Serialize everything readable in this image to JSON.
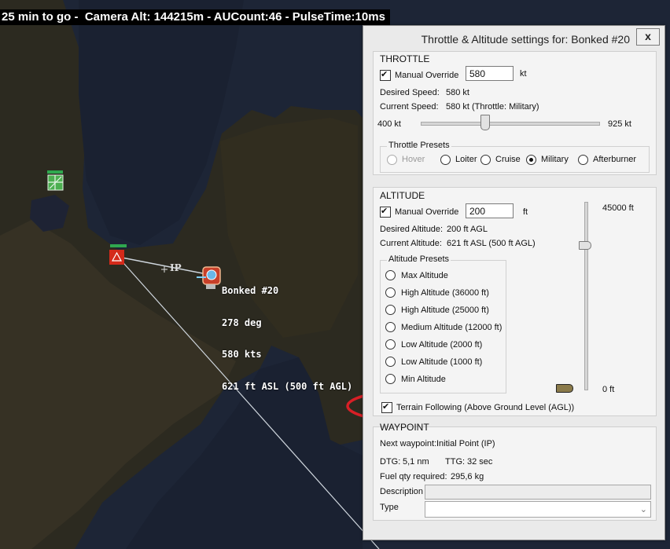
{
  "status_bar": {
    "text": "25 min to go -  Camera Alt: 144215m - AUCount:46 - PulseTime:10ms"
  },
  "map": {
    "ip_label": "IP",
    "unit": {
      "name": "Bonked #20",
      "heading": "278 deg",
      "speed": "580 kts",
      "altitude": "621 ft ASL (500 ft AGL)"
    },
    "colors": {
      "unit_marker": "#d42a1a",
      "facility_marker": "#3fbf3f",
      "annotation_ring": "#d81f26"
    }
  },
  "dialog": {
    "title": "Throttle & Altitude settings for: Bonked #20",
    "close_label": "x",
    "throttle": {
      "section_title": "THROTTLE",
      "manual_override_label": "Manual Override",
      "manual_override_checked": true,
      "speed_value": "580",
      "speed_unit": "kt",
      "desired_speed_label": "Desired Speed:",
      "desired_speed_value": "580 kt",
      "current_speed_label": "Current Speed:",
      "current_speed_value": "580 kt (Throttle: Military)",
      "slider_min": "400 kt",
      "slider_max": "925 kt",
      "slider_fraction": 0.35,
      "presets_title": "Throttle Presets",
      "presets": [
        {
          "label": "Hover",
          "selected": false,
          "enabled": false
        },
        {
          "label": "Loiter",
          "selected": false,
          "enabled": true
        },
        {
          "label": "Cruise",
          "selected": false,
          "enabled": true
        },
        {
          "label": "Military",
          "selected": true,
          "enabled": true
        },
        {
          "label": "Afterburner",
          "selected": false,
          "enabled": true
        }
      ]
    },
    "altitude": {
      "section_title": "ALTITUDE",
      "manual_override_label": "Manual Override",
      "manual_override_checked": true,
      "altitude_value": "200",
      "altitude_unit": "ft",
      "desired_altitude_label": "Desired Altitude:",
      "desired_altitude_value": "200 ft AGL",
      "current_altitude_label": "Current Altitude:",
      "current_altitude_value": "621 ft ASL (500 ft AGL)",
      "slider_top_label": "45000 ft",
      "slider_bottom_label": "0 ft",
      "slider_fraction": 0.78,
      "presets_title": "Altitude Presets",
      "presets": [
        {
          "label": "Max Altitude",
          "selected": false
        },
        {
          "label": "High Altitude (36000 ft)",
          "selected": false
        },
        {
          "label": "High Altitude (25000 ft)",
          "selected": false
        },
        {
          "label": "Medium Altitude (12000 ft)",
          "selected": false
        },
        {
          "label": "Low Altitude (2000 ft)",
          "selected": false
        },
        {
          "label": "Low Altitude (1000 ft)",
          "selected": false
        },
        {
          "label": "Min Altitude",
          "selected": false
        }
      ],
      "terrain_following_label": "Terrain Following (Above Ground Level (AGL))",
      "terrain_following_checked": true
    },
    "waypoint": {
      "section_title": "WAYPOINT",
      "next_waypoint_label": "Next waypoint:",
      "next_waypoint_value": "Initial Point (IP)",
      "dtg_label": "DTG:",
      "dtg_value": "5,1 nm",
      "ttg_label": "TTG:",
      "ttg_value": "32 sec",
      "fuel_label": "Fuel qty required:",
      "fuel_value": "295,6 kg",
      "description_label": "Description",
      "description_value": "",
      "type_label": "Type",
      "type_value": ""
    }
  }
}
